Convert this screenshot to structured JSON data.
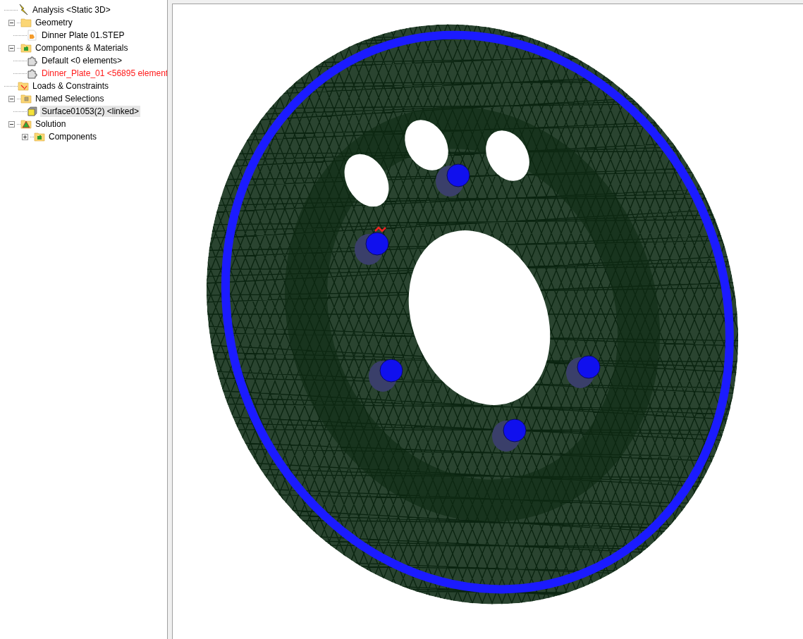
{
  "tree": [
    {
      "label": "Analysis <Static 3D>",
      "kind": "analysis",
      "error": false,
      "selected": false
    },
    {
      "label": "Geometry",
      "kind": "folder",
      "expanded": true,
      "error": false,
      "selected": false,
      "children": [
        {
          "label": "Dinner Plate 01.STEP",
          "kind": "file",
          "error": false,
          "selected": false
        }
      ]
    },
    {
      "label": "Components & Materials",
      "kind": "components",
      "expanded": true,
      "error": false,
      "selected": false,
      "children": [
        {
          "label": "Default <0 elements>",
          "kind": "part",
          "error": false,
          "selected": false
        },
        {
          "label": "Dinner_Plate_01 <56895 element",
          "kind": "part",
          "error": true,
          "selected": false
        }
      ]
    },
    {
      "label": "Loads & Constraints",
      "kind": "loads",
      "error": false,
      "selected": false
    },
    {
      "label": "Named Selections",
      "kind": "selections",
      "expanded": true,
      "error": false,
      "selected": false,
      "children": [
        {
          "label": "Surface01053(2) <linked>",
          "kind": "surface",
          "error": false,
          "selected": true
        }
      ]
    },
    {
      "label": "Solution",
      "kind": "solution",
      "expanded": true,
      "error": false,
      "selected": false,
      "children": [
        {
          "label": "Components",
          "kind": "components",
          "expanded": false,
          "error": false,
          "selected": false
        }
      ]
    }
  ]
}
